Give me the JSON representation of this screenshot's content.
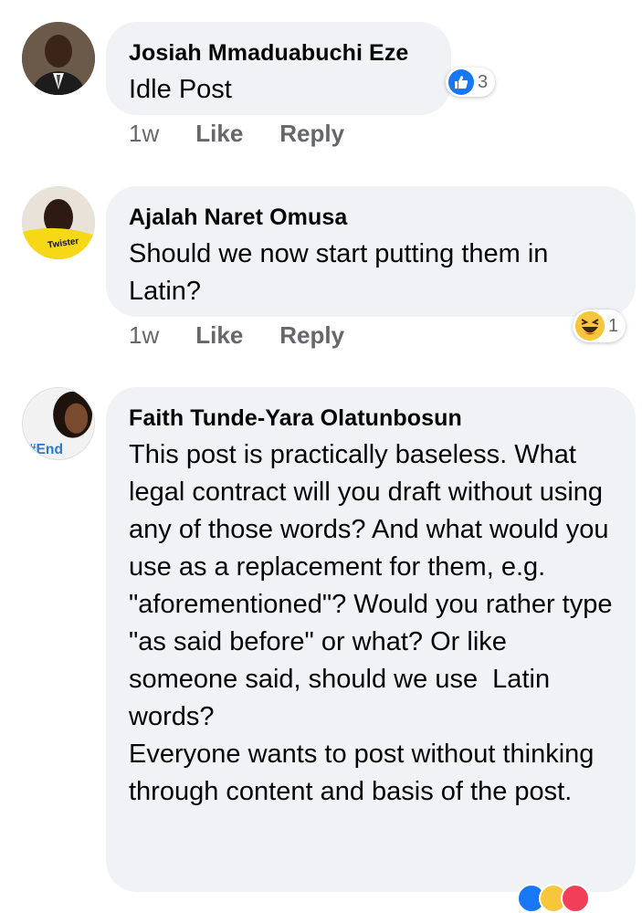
{
  "comments": [
    {
      "author": "Josiah Mmaduabuchi Eze",
      "text": "Idle Post",
      "time": "1w",
      "like_label": "Like",
      "reply_label": "Reply",
      "reaction_count": "3",
      "reaction_icon": "like-icon"
    },
    {
      "author": "Ajalah Naret Omusa",
      "text": "Should we now start putting them in Latin?",
      "time": "1w",
      "like_label": "Like",
      "reply_label": "Reply",
      "reaction_count": "1",
      "reaction_icon": "haha-icon",
      "avatar_badge": "Twister"
    },
    {
      "author": "Faith Tunde-Yara Olatunbosun",
      "text": "This post is practically baseless. What legal contract will you draft without using any of those words? And what would you use as a replacement for them, e.g. \"aforementioned\"? Would you rather type \"as said before\" or what? Or like someone said, should we use  Latin words?\nEveryone wants to post without thinking through content and basis of the post.",
      "avatar_badge": "#End",
      "reaction_icons": [
        "like-icon",
        "haha-icon",
        "love-icon"
      ]
    }
  ],
  "colors": {
    "bubble": "#f0f2f5",
    "meta_text": "#65676b",
    "like_blue": "#1877f2",
    "haha_yellow": "#f7c63d",
    "love_red": "#f33e58"
  }
}
